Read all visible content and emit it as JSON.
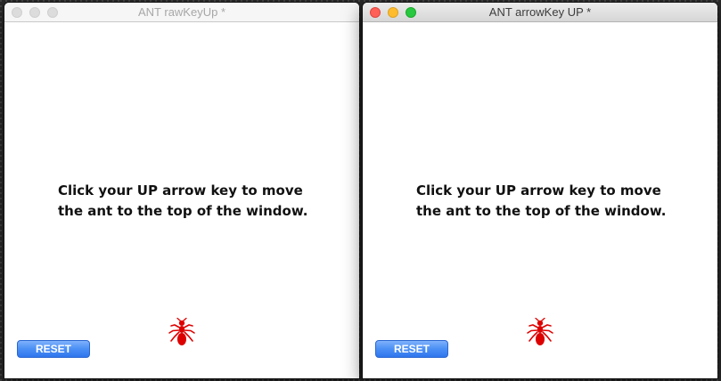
{
  "windows": [
    {
      "title": "ANT rawKeyUp *",
      "active": false,
      "instruction_line1": "Click your UP arrow key to move",
      "instruction_line2": "the ant to the top of the window.",
      "reset_label": "RESET",
      "ant_icon": "ant-icon"
    },
    {
      "title": "ANT arrowKey UP *",
      "active": true,
      "instruction_line1": "Click your UP arrow key to move",
      "instruction_line2": "the ant to the top of the window.",
      "reset_label": "RESET",
      "ant_icon": "ant-icon"
    }
  ],
  "colors": {
    "ant": "#dd0000",
    "reset_button": "#4a8ff5",
    "close": "#fe5f57",
    "minimize": "#febc2e",
    "zoom": "#28c840"
  }
}
